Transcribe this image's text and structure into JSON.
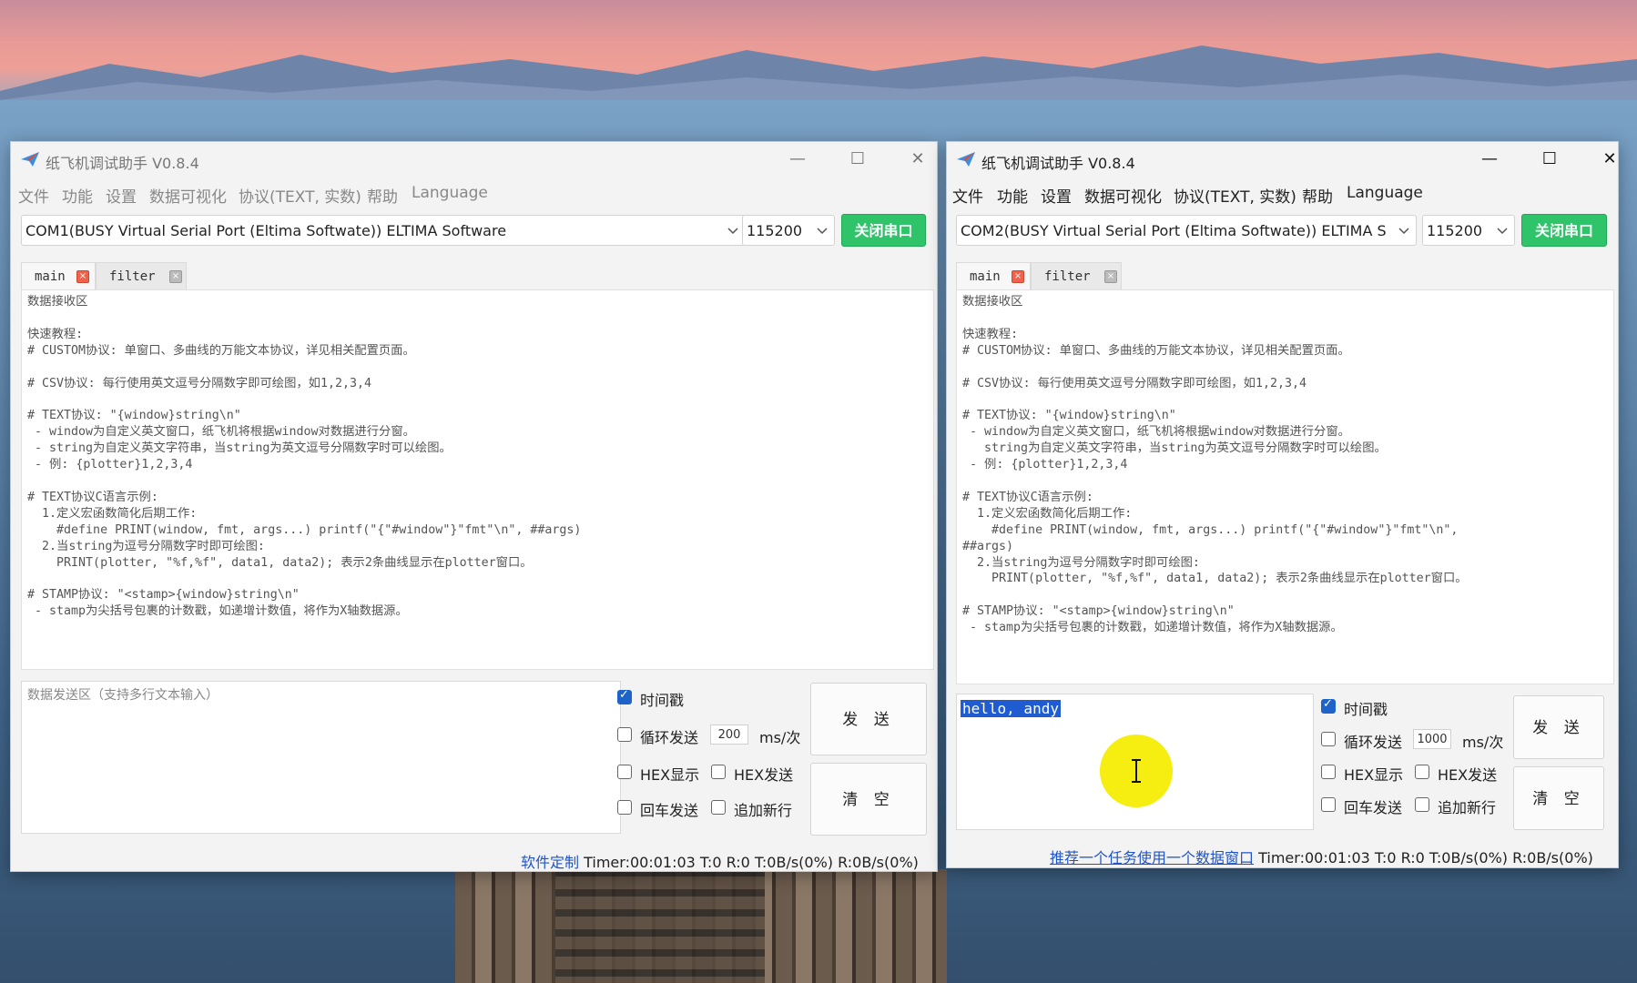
{
  "colors": {
    "accent_green": "#2fc46a",
    "link_blue": "#1f54c9",
    "selection": "#1f5bd1",
    "highlight": "#f5ee10"
  },
  "left_window": {
    "title": "纸飞机调试助手 V0.8.4",
    "controls": {
      "minimize": "—",
      "maximize": "☐",
      "close": "✕"
    },
    "menu": [
      "文件",
      "功能",
      "设置",
      "数据可视化",
      "协议(TEXT, 实数)",
      "帮助",
      "Language"
    ],
    "port": "COM1(BUSY  Virtual Serial Port (Eltima Softwate)) ELTIMA Software",
    "baud": "115200",
    "close_port_label": "关闭串口",
    "tabs": [
      {
        "label": "main",
        "close": "×"
      },
      {
        "label": "filter",
        "close": "×"
      }
    ],
    "receive_text": "数据接收区\n\n快速教程:\n# CUSTOM协议: 单窗口、多曲线的万能文本协议，详见相关配置页面。\n\n# CSV协议: 每行使用英文逗号分隔数字即可绘图，如1,2,3,4\n\n# TEXT协议: \"{window}string\\n\"\n - window为自定义英文窗口，纸飞机将根据window对数据进行分窗。\n - string为自定义英文字符串，当string为英文逗号分隔数字时可以绘图。\n - 例: {plotter}1,2,3,4\n\n# TEXT协议C语言示例:\n  1.定义宏函数简化后期工作:\n    #define PRINT(window, fmt, args...) printf(\"{\"#window\"}\"fmt\"\\n\", ##args)\n  2.当string为逗号分隔数字时即可绘图:\n    PRINT(plotter, \"%f,%f\", data1, data2); 表示2条曲线显示在plotter窗口。\n\n# STAMP协议: \"<stamp>{window}string\\n\"\n - stamp为尖括号包裹的计数戳，如递增计数值，将作为X轴数据源。",
    "send_placeholder": "数据发送区（支持多行文本输入）",
    "options": {
      "timestamp": {
        "label": "时间戳",
        "checked": true
      },
      "loop_send": {
        "label": "循环发送",
        "checked": false,
        "interval": "200",
        "unit": "ms/次"
      },
      "hex_show": {
        "label": "HEX显示",
        "checked": false
      },
      "hex_send": {
        "label": "HEX发送",
        "checked": false
      },
      "enter_send": {
        "label": "回车发送",
        "checked": false
      },
      "append_newline": {
        "label": "追加新行",
        "checked": false
      }
    },
    "send_label": "发 送",
    "clear_label": "清 空",
    "status": {
      "link": "软件定制",
      "timer": "Timer:00:01:03",
      "tr": "T:0 R:0",
      "rate": "T:0B/s(0%) R:0B/s(0%)"
    }
  },
  "right_window": {
    "title": "纸飞机调试助手 V0.8.4",
    "controls": {
      "minimize": "—",
      "maximize": "☐",
      "close": "✕"
    },
    "menu": [
      "文件",
      "功能",
      "设置",
      "数据可视化",
      "协议(TEXT, 实数)",
      "帮助",
      "Language"
    ],
    "port": "COM2(BUSY  Virtual Serial Port (Eltima Softwate)) ELTIMA S",
    "baud": "115200",
    "close_port_label": "关闭串口",
    "tabs": [
      {
        "label": "main",
        "close": "×"
      },
      {
        "label": "filter",
        "close": "×"
      }
    ],
    "receive_text": "数据接收区\n\n快速教程:\n# CUSTOM协议: 单窗口、多曲线的万能文本协议，详见相关配置页面。\n\n# CSV协议: 每行使用英文逗号分隔数字即可绘图，如1,2,3,4\n\n# TEXT协议: \"{window}string\\n\"\n - window为自定义英文窗口，纸飞机将根据window对数据进行分窗。\n   string为自定义英文字符串，当string为英文逗号分隔数字时可以绘图。\n - 例: {plotter}1,2,3,4\n\n# TEXT协议C语言示例:\n  1.定义宏函数简化后期工作:\n    #define PRINT(window, fmt, args...) printf(\"{\"#window\"}\"fmt\"\\n\",\n##args)\n  2.当string为逗号分隔数字时即可绘图:\n    PRINT(plotter, \"%f,%f\", data1, data2); 表示2条曲线显示在plotter窗口。\n\n# STAMP协议: \"<stamp>{window}string\\n\"\n - stamp为尖括号包裹的计数戳，如递增计数值，将作为X轴数据源。",
    "send_value": "hello, andy",
    "options": {
      "timestamp": {
        "label": "时间戳",
        "checked": true
      },
      "loop_send": {
        "label": "循环发送",
        "checked": false,
        "interval": "1000",
        "unit": "ms/次"
      },
      "hex_show": {
        "label": "HEX显示",
        "checked": false
      },
      "hex_send": {
        "label": "HEX发送",
        "checked": false
      },
      "enter_send": {
        "label": "回车发送",
        "checked": false
      },
      "append_newline": {
        "label": "追加新行",
        "checked": false
      }
    },
    "send_label": "发 送",
    "clear_label": "清 空",
    "status": {
      "link": "推荐一个任务使用一个数据窗口",
      "timer": "Timer:00:01:03",
      "tr": "T:0 R:0",
      "rate": "T:0B/s(0%) R:0B/s(0%)"
    }
  }
}
